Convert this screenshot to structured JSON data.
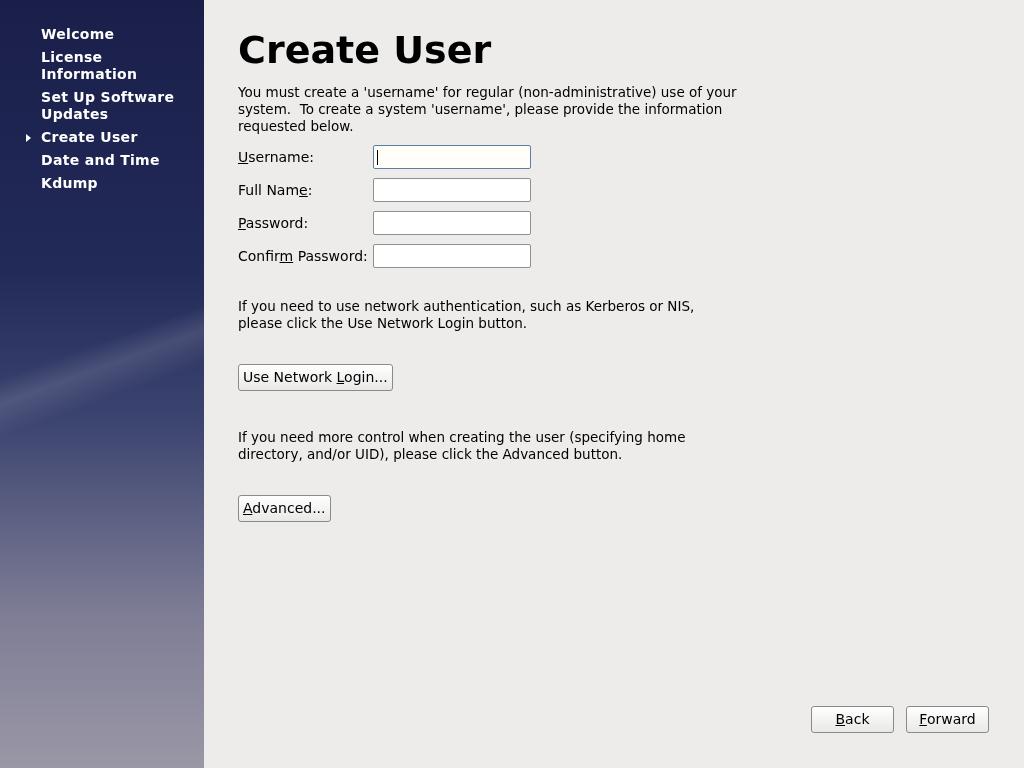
{
  "sidebar": {
    "items": [
      {
        "label": "Welcome",
        "selected": false
      },
      {
        "label": "License Information",
        "selected": false
      },
      {
        "label": "Set Up Software Updates",
        "selected": false
      },
      {
        "label": "Create User",
        "selected": true
      },
      {
        "label": "Date and Time",
        "selected": false
      },
      {
        "label": "Kdump",
        "selected": false
      }
    ]
  },
  "title": "Create User",
  "intro": "You must create a 'username' for regular (non-administrative) use of your system.  To create a system 'username', please provide the information requested below.",
  "fields": [
    {
      "label": {
        "key": "U",
        "after": "sername:"
      },
      "focused": true
    },
    {
      "label": {
        "before": "Full Nam",
        "key": "e",
        "after": ":"
      },
      "focused": false
    },
    {
      "label": {
        "key": "P",
        "after": "assword:"
      },
      "focused": false
    },
    {
      "label": {
        "before": "Confir",
        "key": "m",
        "after": " Password:"
      },
      "focused": false
    }
  ],
  "network_note": "If you need to use network authentication, such as Kerberos or NIS, please click the Use Network Login button.",
  "network_button": {
    "before": "Use Network ",
    "key": "L",
    "after": "ogin..."
  },
  "advanced_note": "If you need more control when creating the user (specifying home directory, and/or UID), please click the Advanced button.",
  "advanced_button": {
    "key": "A",
    "after": "dvanced..."
  },
  "nav_buttons": [
    {
      "key": "B",
      "after": "ack"
    },
    {
      "key": "F",
      "after": "orward"
    }
  ]
}
